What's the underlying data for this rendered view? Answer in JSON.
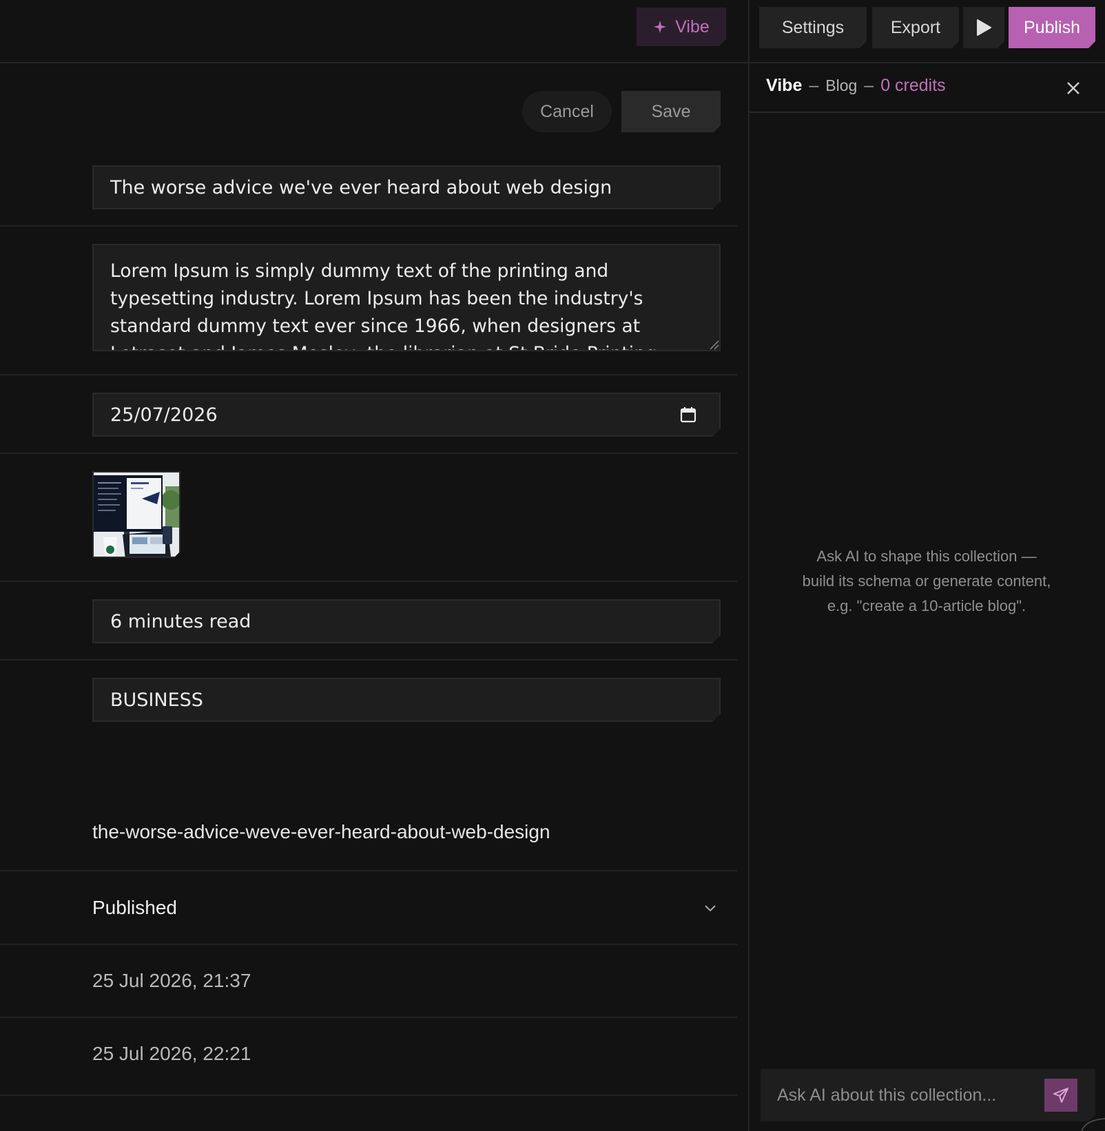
{
  "topbar": {
    "vibe_label": "Vibe",
    "settings_label": "Settings",
    "export_label": "Export",
    "publish_label": "Publish"
  },
  "editor": {
    "cancel_label": "Cancel",
    "save_label": "Save",
    "title_value": "The worse advice we've ever heard about web design",
    "excerpt_value": "Lorem Ipsum is simply dummy text of the printing and typesetting industry. Lorem Ipsum has been the industry's standard dummy text ever since 1966, when designers at Letraset and James Mosley, the librarian at St Bride Printing",
    "date_value": "25/07/2026",
    "read_time_value": "6 minutes read",
    "category_value": "BUSINESS",
    "slug_value": "the-worse-advice-weve-ever-heard-about-web-design",
    "status_value": "Published",
    "created_at": "25 Jul 2026, 21:37",
    "updated_at": "25 Jul 2026, 22:21"
  },
  "vibe_panel": {
    "title": "Vibe",
    "separator": "–",
    "collection": "Blog",
    "credits": "0 credits",
    "empty_hint": "Ask AI to shape this collection — build its schema or generate content, e.g. \"create a 10-article blog\".",
    "input_placeholder": "Ask AI about this collection..."
  },
  "colors": {
    "background": "#121212",
    "accent": "#b860b1",
    "accent_text": "#c06fbb",
    "field_bg": "#1e1e1e"
  },
  "icons": {
    "vibe": "sparkle-icon",
    "play": "play-icon",
    "calendar": "calendar-icon",
    "status": "chevron-down-icon",
    "close": "close-icon",
    "send": "send-icon"
  }
}
